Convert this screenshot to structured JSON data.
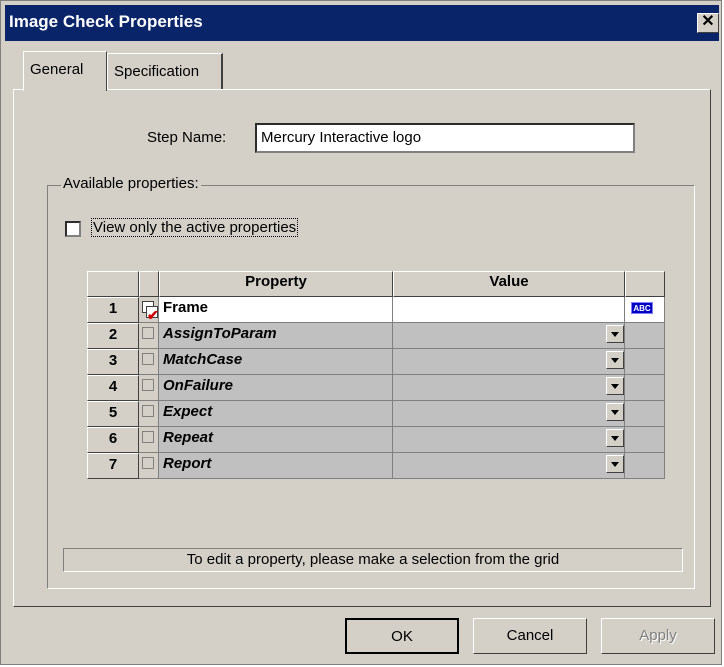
{
  "window": {
    "title": "Image Check Properties",
    "close_glyph": "✕"
  },
  "tabs": [
    {
      "label": "General"
    },
    {
      "label": "Specification"
    }
  ],
  "step_name": {
    "label": "Step Name:",
    "value": "Mercury Interactive logo"
  },
  "available": {
    "group_label": "Available properties:",
    "checkbox_label": "View only the active properties",
    "checkbox_checked": false
  },
  "grid": {
    "headers": {
      "property": "Property",
      "value": "Value"
    },
    "rows": [
      {
        "num": "1",
        "checked": true,
        "property": "Frame",
        "value": "",
        "type_icon": "ABC"
      },
      {
        "num": "2",
        "checked": false,
        "property": "AssignToParam",
        "value": ""
      },
      {
        "num": "3",
        "checked": false,
        "property": "MatchCase",
        "value": ""
      },
      {
        "num": "4",
        "checked": false,
        "property": "OnFailure",
        "value": ""
      },
      {
        "num": "5",
        "checked": false,
        "property": "Expect",
        "value": ""
      },
      {
        "num": "6",
        "checked": false,
        "property": "Repeat",
        "value": ""
      },
      {
        "num": "7",
        "checked": false,
        "property": "Report",
        "value": ""
      }
    ]
  },
  "status_text": "To edit a property, please make a selection from the grid",
  "buttons": {
    "ok": "OK",
    "cancel": "Cancel",
    "apply": "Apply"
  },
  "colors": {
    "titlebar": "#0a246a",
    "dialog_bg": "#d4d0c8",
    "check_tick": "#d00000"
  }
}
